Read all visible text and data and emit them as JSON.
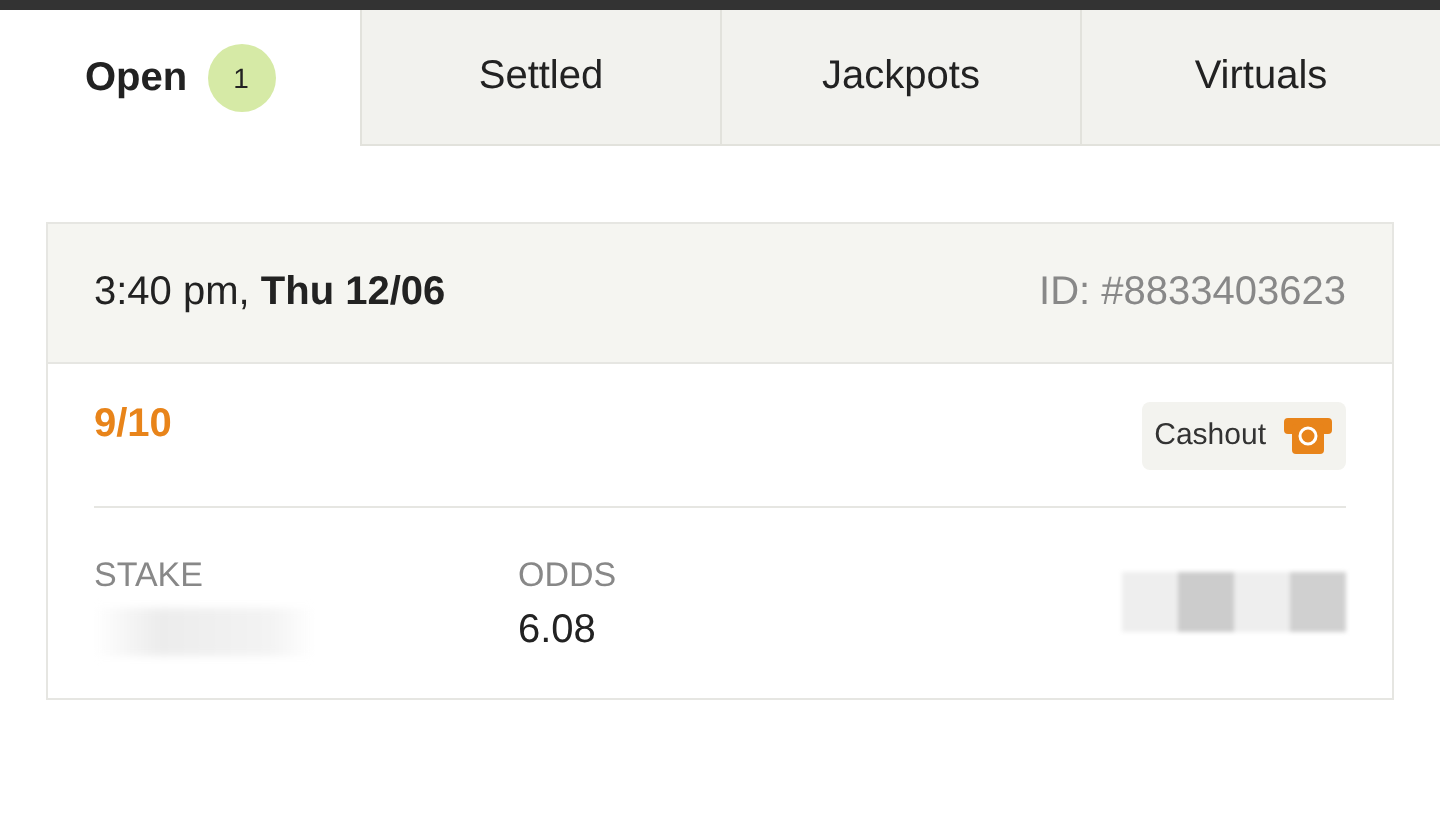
{
  "tabs": [
    {
      "label": "Open",
      "badge": "1",
      "selected": true
    },
    {
      "label": "Settled",
      "selected": false
    },
    {
      "label": "Jackpots",
      "selected": false
    },
    {
      "label": "Virtuals",
      "selected": false
    }
  ],
  "bet": {
    "datetime": "3:40 pm, **Thu 12/06**",
    "id": "ID: #8833403623",
    "progress": "9/10",
    "cashout": "Cashout",
    "fields": [
      {
        "kind": "redacted",
        "label": "STAKE"
      },
      {
        "kind": "text",
        "label": "ODDS",
        "value": "6.08"
      },
      {
        "kind": "hidden"
      }
    ]
  }
}
